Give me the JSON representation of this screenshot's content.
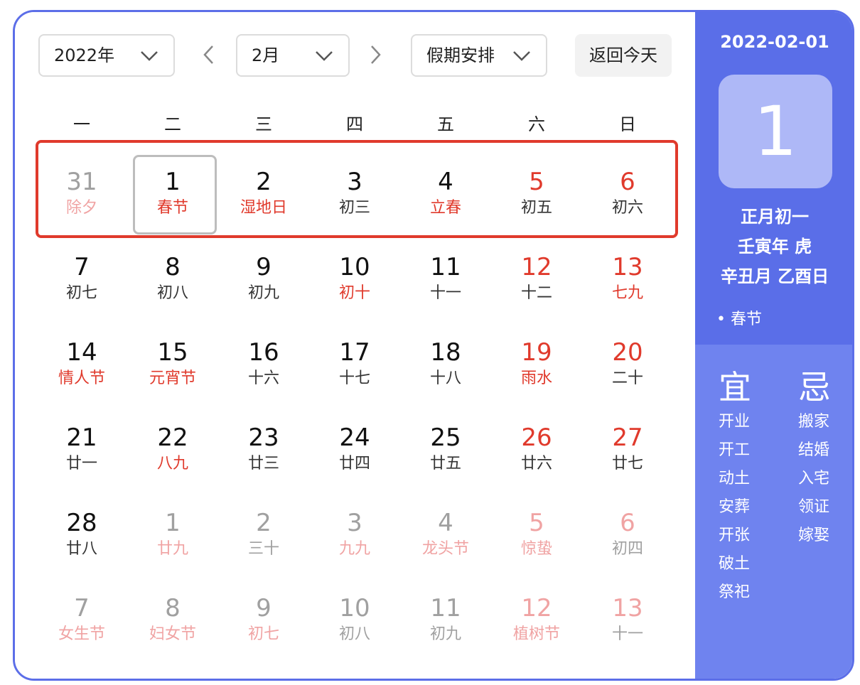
{
  "toolbar": {
    "year": "2022年",
    "month": "2月",
    "holiday": "假期安排",
    "today_btn": "返回今天"
  },
  "weekdays": [
    "一",
    "二",
    "三",
    "四",
    "五",
    "六",
    "日"
  ],
  "weeks": [
    [
      {
        "d": "31",
        "l": "除夕",
        "dim": true,
        "red": false,
        "lred": true
      },
      {
        "d": "1",
        "l": "春节",
        "dim": false,
        "red": false,
        "lred": true,
        "selected": true
      },
      {
        "d": "2",
        "l": "湿地日",
        "dim": false,
        "red": false,
        "lred": true
      },
      {
        "d": "3",
        "l": "初三",
        "dim": false,
        "red": false,
        "lred": false
      },
      {
        "d": "4",
        "l": "立春",
        "dim": false,
        "red": false,
        "lred": true
      },
      {
        "d": "5",
        "l": "初五",
        "dim": false,
        "red": true,
        "lred": false
      },
      {
        "d": "6",
        "l": "初六",
        "dim": false,
        "red": true,
        "lred": false
      }
    ],
    [
      {
        "d": "7",
        "l": "初七",
        "dim": false,
        "red": false,
        "lred": false
      },
      {
        "d": "8",
        "l": "初八",
        "dim": false,
        "red": false,
        "lred": false
      },
      {
        "d": "9",
        "l": "初九",
        "dim": false,
        "red": false,
        "lred": false
      },
      {
        "d": "10",
        "l": "初十",
        "dim": false,
        "red": false,
        "lred": true
      },
      {
        "d": "11",
        "l": "十一",
        "dim": false,
        "red": false,
        "lred": false
      },
      {
        "d": "12",
        "l": "十二",
        "dim": false,
        "red": true,
        "lred": false
      },
      {
        "d": "13",
        "l": "七九",
        "dim": false,
        "red": true,
        "lred": true
      }
    ],
    [
      {
        "d": "14",
        "l": "情人节",
        "dim": false,
        "red": false,
        "lred": true
      },
      {
        "d": "15",
        "l": "元宵节",
        "dim": false,
        "red": false,
        "lred": true
      },
      {
        "d": "16",
        "l": "十六",
        "dim": false,
        "red": false,
        "lred": false
      },
      {
        "d": "17",
        "l": "十七",
        "dim": false,
        "red": false,
        "lred": false
      },
      {
        "d": "18",
        "l": "十八",
        "dim": false,
        "red": false,
        "lred": false
      },
      {
        "d": "19",
        "l": "雨水",
        "dim": false,
        "red": true,
        "lred": true
      },
      {
        "d": "20",
        "l": "二十",
        "dim": false,
        "red": true,
        "lred": false
      }
    ],
    [
      {
        "d": "21",
        "l": "廿一",
        "dim": false,
        "red": false,
        "lred": false
      },
      {
        "d": "22",
        "l": "八九",
        "dim": false,
        "red": false,
        "lred": true
      },
      {
        "d": "23",
        "l": "廿三",
        "dim": false,
        "red": false,
        "lred": false
      },
      {
        "d": "24",
        "l": "廿四",
        "dim": false,
        "red": false,
        "lred": false
      },
      {
        "d": "25",
        "l": "廿五",
        "dim": false,
        "red": false,
        "lred": false
      },
      {
        "d": "26",
        "l": "廿六",
        "dim": false,
        "red": true,
        "lred": false
      },
      {
        "d": "27",
        "l": "廿七",
        "dim": false,
        "red": true,
        "lred": false
      }
    ],
    [
      {
        "d": "28",
        "l": "廿八",
        "dim": false,
        "red": false,
        "lred": false
      },
      {
        "d": "1",
        "l": "廿九",
        "dim": true,
        "red": false,
        "lred": true
      },
      {
        "d": "2",
        "l": "三十",
        "dim": true,
        "red": false,
        "lred": false
      },
      {
        "d": "3",
        "l": "九九",
        "dim": true,
        "red": false,
        "lred": true
      },
      {
        "d": "4",
        "l": "龙头节",
        "dim": true,
        "red": false,
        "lred": true
      },
      {
        "d": "5",
        "l": "惊蛰",
        "dim": true,
        "red": true,
        "lred": true
      },
      {
        "d": "6",
        "l": "初四",
        "dim": true,
        "red": true,
        "lred": false
      }
    ],
    [
      {
        "d": "7",
        "l": "女生节",
        "dim": true,
        "red": false,
        "lred": true
      },
      {
        "d": "8",
        "l": "妇女节",
        "dim": true,
        "red": false,
        "lred": true
      },
      {
        "d": "9",
        "l": "初七",
        "dim": true,
        "red": false,
        "lred": true
      },
      {
        "d": "10",
        "l": "初八",
        "dim": true,
        "red": false,
        "lred": false
      },
      {
        "d": "11",
        "l": "初九",
        "dim": true,
        "red": false,
        "lred": false
      },
      {
        "d": "12",
        "l": "植树节",
        "dim": true,
        "red": true,
        "lred": true
      },
      {
        "d": "13",
        "l": "十一",
        "dim": true,
        "red": true,
        "lred": false
      }
    ]
  ],
  "sidebar": {
    "date": "2022-02-01",
    "big_day": "1",
    "lunar": "正月初一",
    "year_gz": "壬寅年 虎",
    "month_day_gz": "辛丑月 乙酉日",
    "festival": "• 春节",
    "yi_title": "宜",
    "ji_title": "忌",
    "yi": [
      "开业",
      "开工",
      "动土",
      "安葬",
      "开张",
      "破土",
      "祭祀"
    ],
    "ji": [
      "搬家",
      "结婚",
      "入宅",
      "领证",
      "嫁娶"
    ]
  },
  "colors": {
    "accent": "#5a6ee8",
    "sidebar_light": "#6f83ef",
    "holiday_red": "#e03a2c",
    "dim_red": "#f0a3a3",
    "dim_gray": "#a0a0a0"
  }
}
